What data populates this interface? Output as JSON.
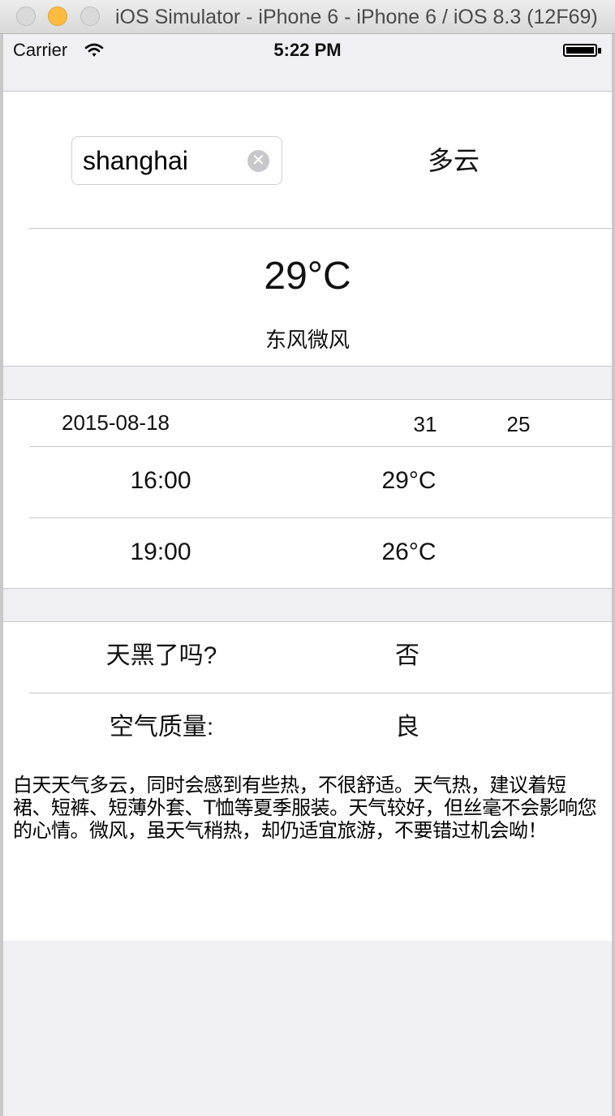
{
  "window": {
    "title": "iOS Simulator - iPhone 6 - iPhone 6 / iOS 8.3 (12F69)"
  },
  "status_bar": {
    "carrier": "Carrier",
    "time": "5:22 PM"
  },
  "current": {
    "city_input_value": "shanghai",
    "weather": "多云",
    "temperature": "29°C",
    "wind": "东风微风"
  },
  "forecast": {
    "date": "2015-08-18",
    "high": "31",
    "low": "25",
    "hours": [
      {
        "time": "16:00",
        "temp": "29°C"
      },
      {
        "time": "19:00",
        "temp": "26°C"
      }
    ]
  },
  "info": {
    "rows": [
      {
        "label": "天黑了吗?",
        "value": "否"
      },
      {
        "label": "空气质量:",
        "value": "良"
      }
    ]
  },
  "description": "白天天气多云，同时会感到有些热，不很舒适。天气热，建议着短裙、短裤、短薄外套、T恤等夏季服装。天气较好，但丝毫不会影响您的心情。微风，虽天气稍热，却仍适宜旅游，不要错过机会呦！"
}
